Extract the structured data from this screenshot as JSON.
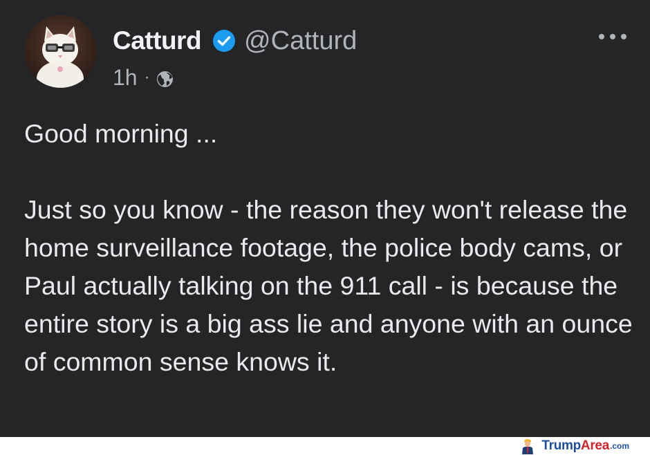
{
  "post": {
    "author": {
      "display_name": "Catturd",
      "handle": "@Catturd",
      "verified": true,
      "avatar_icon": "cat-with-glasses-avatar"
    },
    "meta": {
      "time": "1h",
      "separator": "·",
      "audience_icon": "globe-icon"
    },
    "menu_icon": "more-options-icon",
    "text": {
      "paragraph_1": "Good morning ...",
      "paragraph_2": "Just so you know - the reason they won't release the home surveillance footage, the police body cams, or Paul actually talking on the 911 call - is because the entire story is a big ass lie and anyone with an ounce of common sense knows it."
    }
  },
  "watermark": {
    "brand_part_1": "Trump",
    "brand_part_2": "Area",
    "suffix": ".com"
  },
  "colors": {
    "background": "#242526",
    "text_primary": "#e8eaed",
    "text_secondary": "#b0b3b8",
    "verified_badge": "#1d9bf0"
  }
}
